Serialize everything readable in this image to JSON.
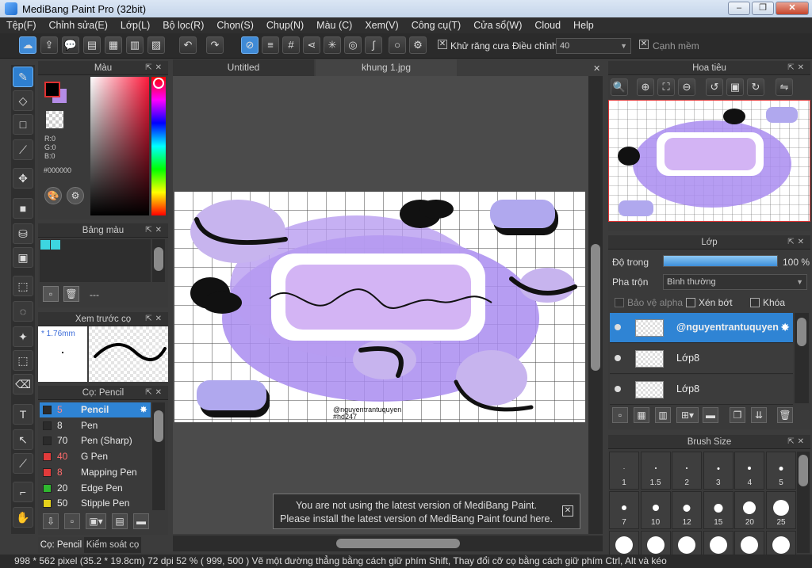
{
  "title": "MediBang Paint Pro (32bit)",
  "menu": [
    "Tệp(F)",
    "Chỉnh sửa(E)",
    "Lớp(L)",
    "Bộ lọc(R)",
    "Chọn(S)",
    "Chụp(N)",
    "Màu (C)",
    "Xem(V)",
    "Công cụ(T)",
    "Cửa sổ(W)",
    "Cloud",
    "Help"
  ],
  "toolbar": {
    "antialias_label": "Khử răng cưa",
    "adjust_label": "Điều chỉnh",
    "adjust_value": "40",
    "smooth_label": "Cạnh mềm"
  },
  "color_panel": {
    "title": "Màu",
    "r": "R:0",
    "g": "G:0",
    "b": "B:0",
    "hex": "#000000"
  },
  "palette_panel": {
    "title": "Bảng màu",
    "empty": "---"
  },
  "preview_panel": {
    "title": "Xem trước cọ",
    "size": "* 1.76mm"
  },
  "brush_panel": {
    "title": "Cọ: Pencil",
    "items": [
      {
        "n": "5",
        "name": "Pencil",
        "color": "#2b2b2b"
      },
      {
        "n": "8",
        "name": "Pen",
        "color": "#2b2b2b"
      },
      {
        "n": "70",
        "name": "Pen (Sharp)",
        "color": "#2b2b2b"
      },
      {
        "n": "40",
        "name": "G Pen",
        "color": "#e23b3b"
      },
      {
        "n": "8",
        "name": "Mapping Pen",
        "color": "#e23b3b"
      },
      {
        "n": "20",
        "name": "Edge Pen",
        "color": "#2fb82f"
      },
      {
        "n": "50",
        "name": "Stipple Pen",
        "color": "#e6d21b"
      }
    ]
  },
  "bottom_tabs": [
    "Cọ: Pencil",
    "Kiểm soát cọ"
  ],
  "tabs": [
    "Untitled",
    "khung 1.jpg"
  ],
  "canvas": {
    "credit": "@nguyentrantuquyen",
    "hashtag": "#hd247"
  },
  "navigator": {
    "title": "Hoa tiêu"
  },
  "layer_panel": {
    "title": "Lớp",
    "opacity_label": "Độ trong",
    "opacity_value": "100 %",
    "opacity_fraction": 1.0,
    "blend_label": "Pha trộn",
    "blend_value": "Bình thường",
    "protect_alpha": "Bảo vệ alpha",
    "clip": "Xén bớt",
    "lock": "Khóa",
    "layers": [
      {
        "name": "@nguyentrantuquyen"
      },
      {
        "name": "Lớp8"
      },
      {
        "name": "Lớp8"
      }
    ]
  },
  "brush_size": {
    "title": "Brush Size",
    "sizes": [
      "1",
      "1.5",
      "2",
      "3",
      "4",
      "5",
      "7",
      "10",
      "12",
      "15",
      "20",
      "25",
      "",
      "",
      "",
      "",
      "",
      ""
    ]
  },
  "notice": {
    "line1": "You are not using the latest version of MediBang Paint.",
    "line2": "Please install the latest version of MediBang Paint found here."
  },
  "status": "998 * 562 pixel   (35.2 * 19.8cm)   72 dpi   52 %   ( 999, 500 )   Vẽ một đường thẳng bằng cách giữ phím Shift, Thay đổi cỡ cọ bằng cách giữ phím Ctrl, Alt và kéo",
  "colors": {
    "accent": "#2f84d4",
    "primary_color": "#000000",
    "secondary_color": "#b48ce6",
    "cyan_swatch": "#3dd6e0"
  }
}
